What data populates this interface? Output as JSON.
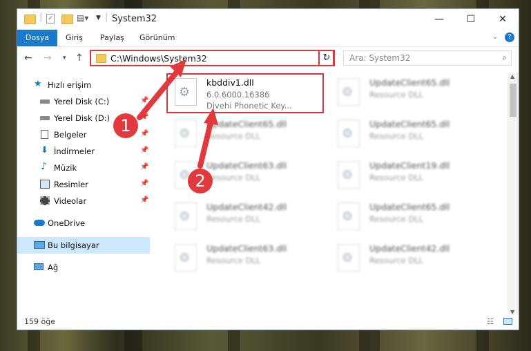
{
  "window": {
    "title": "System32",
    "controls": {
      "minimize": "—",
      "maximize": "☐",
      "close": "✕"
    }
  },
  "ribbon": {
    "tabs": [
      "Dosya",
      "Giriş",
      "Paylaş",
      "Görünüm"
    ]
  },
  "navigation": {
    "address": "C:\\Windows\\System32",
    "search_placeholder": "Ara: System32"
  },
  "sidebar": {
    "items": [
      {
        "label": "Hızlı erişim",
        "icon": "star-icon"
      },
      {
        "label": "Yerel Disk (C:)",
        "icon": "drive-icon",
        "pinned": true
      },
      {
        "label": "Yerel Disk (D:)",
        "icon": "drive-icon",
        "pinned": true
      },
      {
        "label": "Belgeler",
        "icon": "document-icon",
        "pinned": true
      },
      {
        "label": "İndirmeler",
        "icon": "download-icon",
        "pinned": true
      },
      {
        "label": "Müzik",
        "icon": "music-icon",
        "pinned": true
      },
      {
        "label": "Resimler",
        "icon": "pictures-icon",
        "pinned": true
      },
      {
        "label": "Videolar",
        "icon": "video-icon",
        "pinned": true
      },
      {
        "label": "OneDrive",
        "icon": "cloud-icon"
      },
      {
        "label": "Bu bilgisayar",
        "icon": "computer-icon",
        "selected": true
      },
      {
        "label": "Ağ",
        "icon": "network-icon"
      }
    ]
  },
  "files": {
    "main": {
      "name": "kbddiv1.dll",
      "version": "6.0.6000.16386",
      "description": "Divehi Phonetic Key..."
    },
    "blurred": [
      {
        "name": "UpdateClient65.dll",
        "description": "Resource DLL"
      },
      {
        "name": "UpdateClient65.dll",
        "description": "Resource DLL"
      },
      {
        "name": "UpdateClient65.dll",
        "description": "Resource DLL"
      },
      {
        "name": "UpdateClient63.dll",
        "description": "Resource DLL"
      },
      {
        "name": "UpdateClient19.dll",
        "description": "Resource DLL"
      },
      {
        "name": "UpdateClient42.dll",
        "description": "Resource DLL"
      },
      {
        "name": "UpdateClient65.dll",
        "description": "Resource DLL"
      },
      {
        "name": "UpdateClient63.dll",
        "description": "Resource DLL"
      },
      {
        "name": "UpdateClient42.dll",
        "description": "Resource DLL"
      }
    ]
  },
  "status": {
    "count": "159 öğe"
  },
  "callouts": [
    "1",
    "2"
  ],
  "colors": {
    "accent": "#1979ca",
    "highlight": "#d9363e",
    "callout": "#e03a3e",
    "selected": "#cce8ff"
  }
}
